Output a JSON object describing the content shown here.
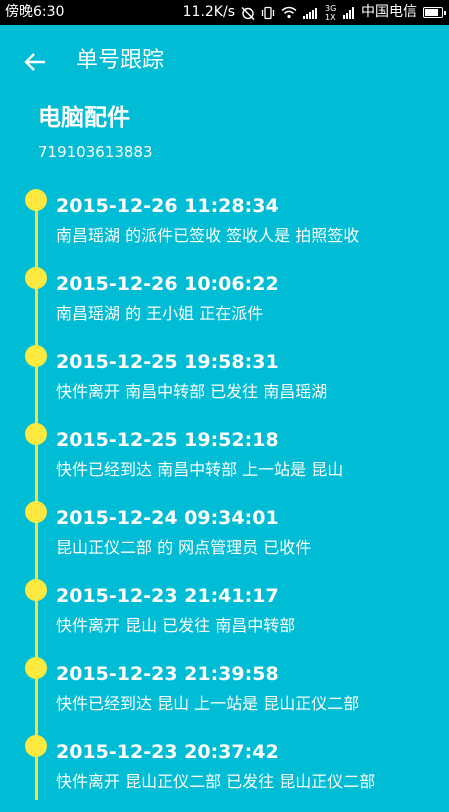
{
  "status_bar": {
    "time": "傍晚6:30",
    "network_speed": "11.2K/s",
    "network_type": "3G 1X",
    "carrier": "中国电信",
    "battery_level": 0.85
  },
  "app_bar": {
    "title": "单号跟踪"
  },
  "package": {
    "name": "电脑配件",
    "tracking_number": "719103613883"
  },
  "events": [
    {
      "time": "2015-12-26 11:28:34",
      "desc": "南昌瑶湖 的派件已签收 签收人是 拍照签收"
    },
    {
      "time": "2015-12-26 10:06:22",
      "desc": "南昌瑶湖 的 王小姐 正在派件"
    },
    {
      "time": "2015-12-25 19:58:31",
      "desc": "快件离开 南昌中转部 已发往 南昌瑶湖"
    },
    {
      "time": "2015-12-25 19:52:18",
      "desc": "快件已经到达 南昌中转部 上一站是 昆山"
    },
    {
      "time": "2015-12-24 09:34:01",
      "desc": "昆山正仪二部 的 网点管理员 已收件"
    },
    {
      "time": "2015-12-23 21:41:17",
      "desc": "快件离开 昆山 已发往 南昌中转部"
    },
    {
      "time": "2015-12-23 21:39:58",
      "desc": "快件已经到达 昆山 上一站是 昆山正仪二部"
    },
    {
      "time": "2015-12-23 20:37:42",
      "desc": "快件离开 昆山正仪二部 已发往 昆山正仪二部"
    }
  ]
}
